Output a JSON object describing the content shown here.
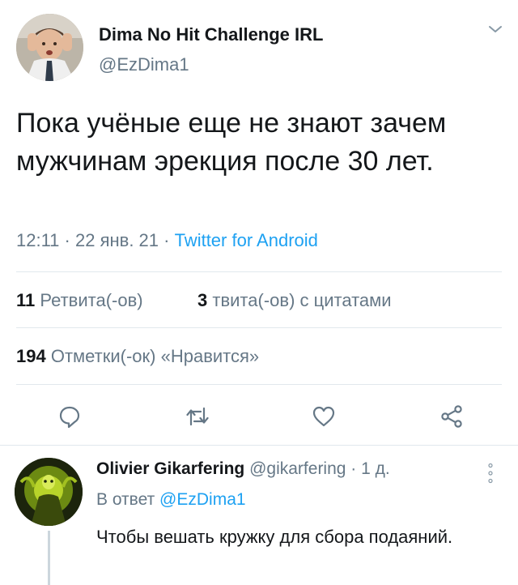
{
  "tweet": {
    "author_name": "Dima No Hit Challenge IRL",
    "author_handle": "@EzDima1",
    "text": "Пока учёные еще не знают зачем мужчинам эрекция после 30 лет.",
    "time": "12:11",
    "date": "22 янв. 21",
    "source": "Twitter for Android",
    "separator": " · "
  },
  "stats": {
    "retweets_count": "11",
    "retweets_label": "Ретвита(-ов)",
    "quotes_count": "3",
    "quotes_label": "твита(-ов) с цитатами",
    "likes_count": "194",
    "likes_label": "Отметки(-ок) «Нравится»"
  },
  "actions": {
    "icons": [
      "reply-icon",
      "retweet-icon",
      "like-icon",
      "share-icon"
    ],
    "color": "#657786"
  },
  "reply": {
    "author_name": "Olivier Gikarfering",
    "author_handle": "@gikarfering",
    "age": "1 д.",
    "separator": " · ",
    "in_reply_prefix": "В ответ",
    "in_reply_handle": "@EzDima1",
    "text": "Чтобы вешать кружку для сбора подаяний."
  },
  "colors": {
    "link": "#1da1f2",
    "secondary_text": "#657786",
    "primary_text": "#14171a",
    "divider": "#e1e8ed"
  }
}
